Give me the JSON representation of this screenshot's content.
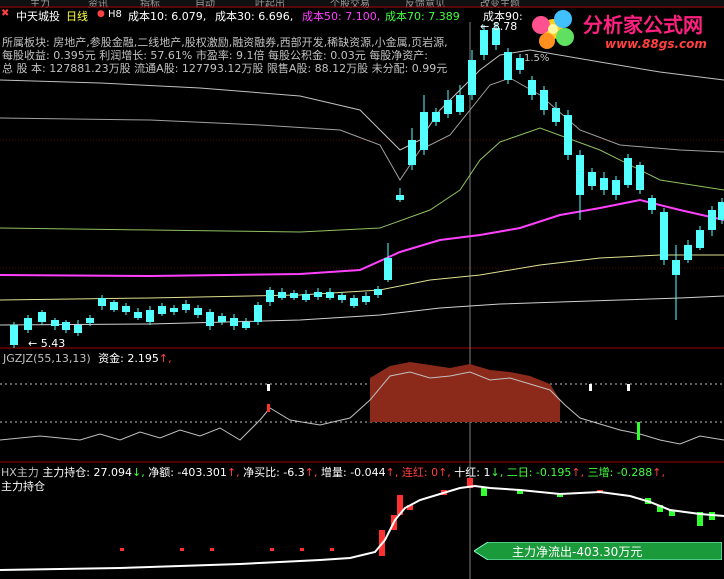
{
  "toolbar": {
    "items": [
      "主力",
      "资讯",
      "指标",
      "自动",
      "吐起出",
      "个股交易",
      "反馈意见",
      "改变主题",
      "发"
    ]
  },
  "header": {
    "close_icon": "x-icon",
    "stock_name": "中天城投",
    "period": "日线",
    "indicator_tag": "H8",
    "ma": [
      {
        "label": "成本10: 6.079,",
        "color": "#ffffff"
      },
      {
        "label": "成本30: 6.696,",
        "color": "#ffffff"
      },
      {
        "label": "成本50: 7.100,",
        "color": "#ff40ff"
      },
      {
        "label": "成本70: 7.389",
        "color": "#40ff40"
      },
      {
        "label": "成本90:",
        "color": "#ffffff"
      }
    ]
  },
  "info": {
    "line1": "所属板块:  房地产,参股金融,二线地产,股权激励,融资融券,西部开发,稀缺资源,小金属,页岩源,",
    "line2": "每股收益:  0.395元    利润增长: 57.61%    市盈率: 9.1倍   每股公积金: 0.03元   每股净资产:",
    "line3": "总 股 本:  127881.23万股   流通A股: 127793.12万股   限售A股: 88.12万股  未分配: 0.99元"
  },
  "main_chart": {
    "high_label": "← 8.78",
    "low_label": "← 5.43",
    "extra_label": "1.5%"
  },
  "sub1": {
    "title": "JGZJZ(55,13,13)",
    "fund_label": "资金: 2.195",
    "arrow": "↑,"
  },
  "sub2": {
    "title_prefix": "HX主力",
    "parts": [
      {
        "text": "主力持仓: 27.094",
        "color": "#ffffff"
      },
      {
        "text": "↓,",
        "color": "#40ff40"
      },
      {
        "text": " 净额: -403.301",
        "color": "#ffffff"
      },
      {
        "text": "↑,",
        "color": "#ff4040"
      },
      {
        "text": " 净买比: -6.3",
        "color": "#ffffff"
      },
      {
        "text": "↑,",
        "color": "#ff4040"
      },
      {
        "text": " 增量: -0.044",
        "color": "#ffffff"
      },
      {
        "text": "↑,",
        "color": "#ff4040"
      },
      {
        "text": " 连红: 0",
        "color": "#ff4040"
      },
      {
        "text": "↑,",
        "color": "#ff4040"
      },
      {
        "text": " 十红: 1",
        "color": "#ffffff"
      },
      {
        "text": "↓,",
        "color": "#40ff40"
      },
      {
        "text": " 二日: -0.195",
        "color": "#40ff40"
      },
      {
        "text": "↑,",
        "color": "#ff4040"
      },
      {
        "text": " 三增: -0.288",
        "color": "#40ff40"
      },
      {
        "text": "↑,",
        "color": "#ff4040"
      }
    ],
    "second_line": "主力持仓",
    "callout": "主力净流出-403.30万元"
  },
  "logo": {
    "text": "分析家公式网",
    "url": "www.88gs.com"
  },
  "colors": {
    "up": "#ff3030",
    "down": "#54ffff",
    "ma_pink": "#ff40ff",
    "ma_yellow": "#e0e090",
    "ma_green": "#90c060",
    "fill": "#8b2a1a"
  }
}
